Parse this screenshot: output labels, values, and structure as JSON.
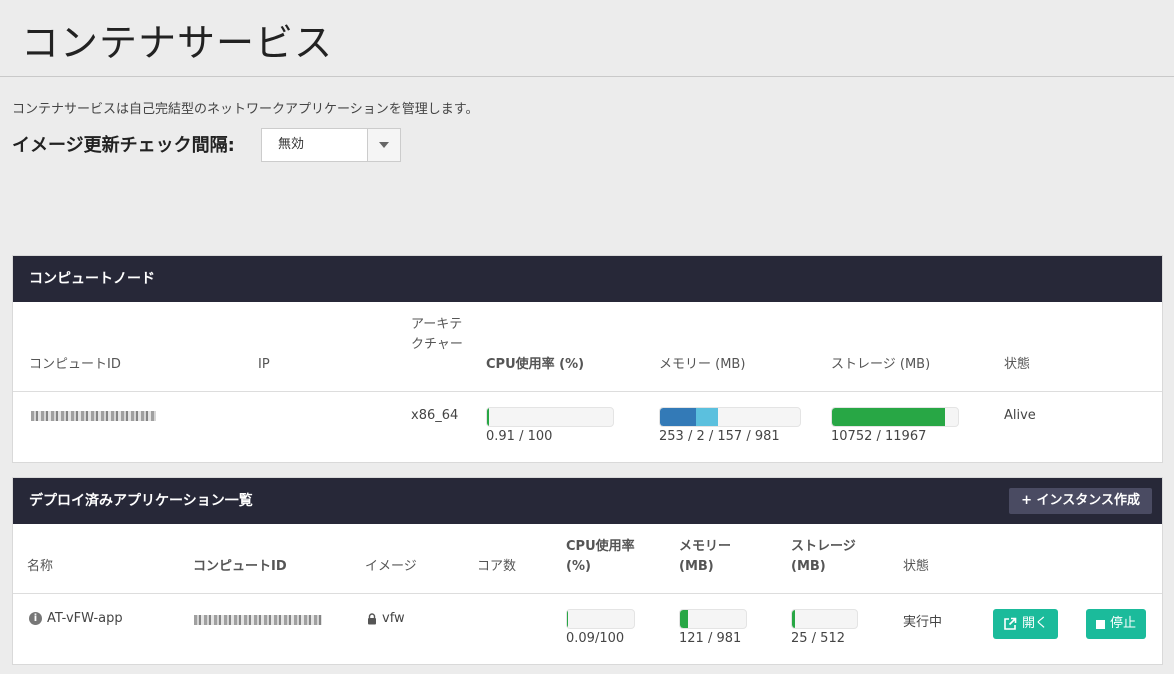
{
  "page": {
    "title": "コンテナサービス",
    "description": "コンテナサービスは自己完結型のネットワークアプリケーションを管理します。",
    "interval_label": "イメージ更新チェック間隔:",
    "interval_value": "無効"
  },
  "compute_nodes": {
    "title": "コンピュートノード",
    "headers": {
      "compute_id": "コンピュートID",
      "ip": "IP",
      "arch": "アーキテクチャー",
      "cpu": "CPU使用率 (%)",
      "memory": "メモリー (MB)",
      "storage": "ストレージ (MB)",
      "status": "状態"
    },
    "rows": [
      {
        "arch": "x86_64",
        "cpu_text": "0.91 / 100",
        "cpu_used": 0.91,
        "cpu_total": 100,
        "memory_text": "253 / 2 / 157 / 981",
        "memory_segments": [
          253,
          157
        ],
        "memory_total": 981,
        "storage_text": "10752 / 11967",
        "storage_used": 10752,
        "storage_total": 11967,
        "status": "Alive"
      }
    ]
  },
  "apps": {
    "title": "デプロイ済みアプリケーション一覧",
    "create_button": "+ インスタンス作成",
    "headers": {
      "name": "名称",
      "compute_id": "コンピュートID",
      "image": "イメージ",
      "cores": "コア数",
      "cpu": "CPU使用率 (%)",
      "memory": "メモリー (MB)",
      "storage": "ストレージ (MB)",
      "status": "状態"
    },
    "rows": [
      {
        "name": "AT-vFW-app",
        "image": "vfw",
        "cores": "",
        "cpu_text": "0.09/100",
        "cpu_used": 0.09,
        "cpu_total": 100,
        "memory_text": "121 / 981",
        "memory_used": 121,
        "memory_total": 981,
        "storage_text": "25 / 512",
        "storage_used": 25,
        "storage_total": 512,
        "status": "実行中",
        "open_label": "開く",
        "stop_label": "停止"
      }
    ]
  },
  "colors": {
    "header_bg": "#272838",
    "bar_green": "#28a745",
    "bar_blue": "#337ab7",
    "bar_light_blue": "#5bc0de",
    "teal": "#1bbb9b"
  }
}
